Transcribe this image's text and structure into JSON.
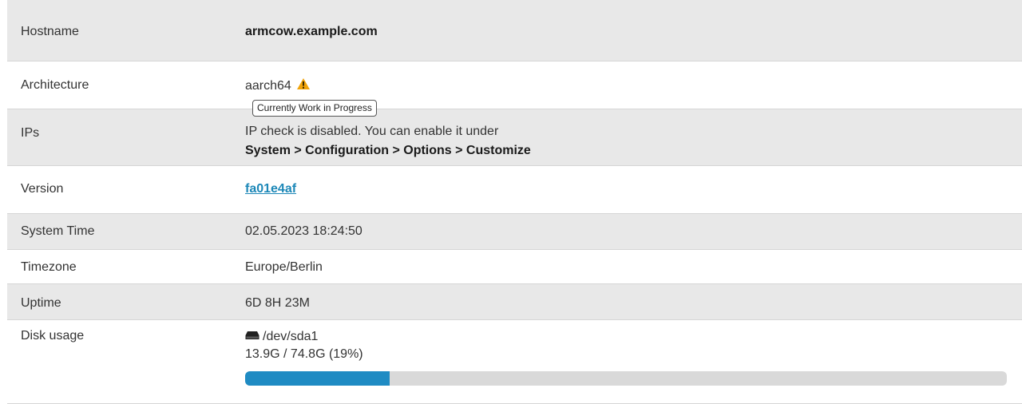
{
  "rows": {
    "hostname": {
      "label": "Hostname",
      "value": "armcow.example.com"
    },
    "architecture": {
      "label": "Architecture",
      "value": "aarch64",
      "warning_icon": "warning-triangle-icon",
      "tooltip": "Currently Work in Progress"
    },
    "ips": {
      "label": "IPs",
      "line1": "IP check is disabled. You can enable it under",
      "line2": "System > Configuration > Options > Customize"
    },
    "version": {
      "label": "Version",
      "value": "fa01e4af"
    },
    "system_time": {
      "label": "System Time",
      "value": "02.05.2023 18:24:50"
    },
    "timezone": {
      "label": "Timezone",
      "value": "Europe/Berlin"
    },
    "uptime": {
      "label": "Uptime",
      "value": "6D 8H 23M"
    },
    "disk": {
      "label": "Disk usage",
      "icon": "hdd-icon",
      "device": "/dev/sda1",
      "usage": "13.9G / 74.8G (19%)",
      "percent": 19
    }
  },
  "colors": {
    "stripe": "#e8e8e8",
    "link": "#1d88b8",
    "progress_fill": "#1f8bc3",
    "progress_track": "#d9d9d9",
    "warning": "#f0a30a"
  }
}
